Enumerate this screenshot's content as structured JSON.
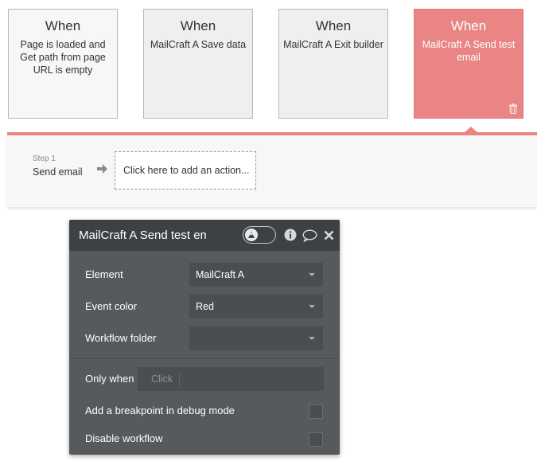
{
  "events": [
    {
      "when": "When",
      "desc": "Page is loaded and Get path from page URL is empty"
    },
    {
      "when": "When",
      "desc": "MailCraft A Save data"
    },
    {
      "when": "When",
      "desc": "MailCraft A Exit builder"
    },
    {
      "when": "When",
      "desc": "MailCraft A Send test email"
    }
  ],
  "workflow": {
    "step_number": "Step 1",
    "step_name": "Send email",
    "add_action": "Click here to add an action..."
  },
  "panel": {
    "title": "MailCraft A Send test em",
    "element_label": "Element",
    "element_value": "MailCraft A",
    "event_color_label": "Event color",
    "event_color_value": "Red",
    "workflow_folder_label": "Workflow folder",
    "workflow_folder_value": "",
    "only_when_label": "Only when",
    "only_when_placeholder": "Click",
    "breakpoint_label": "Add a breakpoint in debug mode",
    "disable_label": "Disable workflow"
  },
  "colors": {
    "accent_red": "#e98584",
    "panel_bg": "#565a5c",
    "panel_header": "#3d4143"
  },
  "icons": {
    "trash": "trash-icon",
    "arrow": "arrow-right-icon",
    "toggle": "person-toggle-icon",
    "info": "info-icon",
    "comment": "comment-icon",
    "close": "close-icon"
  }
}
